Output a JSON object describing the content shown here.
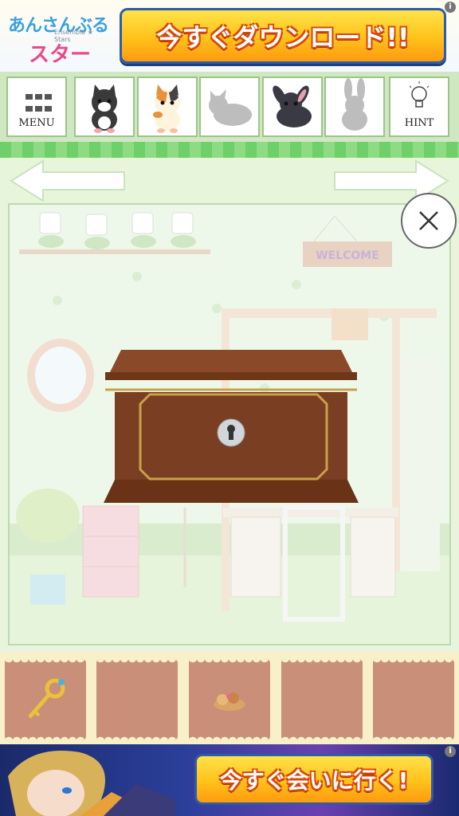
{
  "top_ad": {
    "logo_line1": "あんさんぶる",
    "logo_line2": "Ensemble ★ Stars",
    "logo_line3": "スターズ!",
    "button_label": "今すぐダウンロード!!",
    "info_glyph": "i"
  },
  "toolbar": {
    "menu_label": "MENU",
    "hint_label": "HINT",
    "items": [
      "black-cat",
      "calico-cat",
      "cat-silhouette",
      "black-rabbit",
      "rabbit-silhouette"
    ]
  },
  "room": {
    "sign_text": "WELCOME",
    "close_glyph": "×"
  },
  "inventory": {
    "slots": [
      "golden-key",
      "empty",
      "cookies",
      "empty",
      "empty"
    ]
  },
  "bottom_ad": {
    "button_label": "今すぐ会いに行く!",
    "info_glyph": "i"
  },
  "colors": {
    "accent_green": "#8edb84",
    "ad_button_yellow": "#ffc21a",
    "inventory_slot": "#c98f78",
    "chest_wood": "#7a3e22"
  }
}
